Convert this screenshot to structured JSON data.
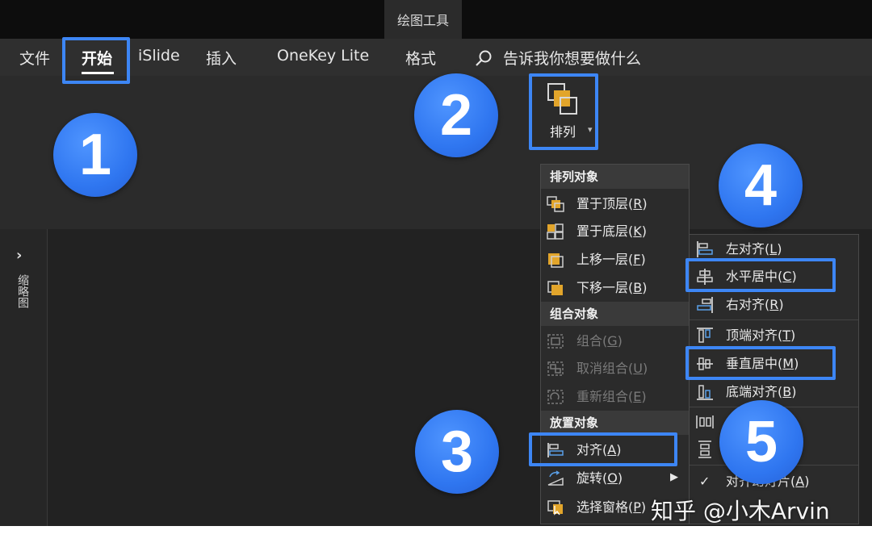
{
  "title_bar": {
    "context_tab": "绘图工具"
  },
  "ribbon_tabs": [
    "文件",
    "开始",
    "iSlide",
    "插入",
    "OneKey Lite",
    "格式"
  ],
  "search": {
    "text": "告诉我你想要做什么"
  },
  "ribbon": {
    "arrange_label": "排列"
  },
  "thumbnail_panel": {
    "label": "缩略图"
  },
  "arrange_menu": {
    "sections": [
      "排列对象",
      "组合对象",
      "放置对象"
    ],
    "items": [
      {
        "label": "置于顶层",
        "key": "R",
        "enabled": true
      },
      {
        "label": "置于底层",
        "key": "K",
        "enabled": true
      },
      {
        "label": "上移一层",
        "key": "F",
        "enabled": true
      },
      {
        "label": "下移一层",
        "key": "B",
        "enabled": true
      },
      {
        "label": "组合",
        "key": "G",
        "enabled": false
      },
      {
        "label": "取消组合",
        "key": "U",
        "enabled": false
      },
      {
        "label": "重新组合",
        "key": "E",
        "enabled": false
      },
      {
        "label": "对齐",
        "key": "A",
        "enabled": true
      },
      {
        "label": "旋转",
        "key": "O",
        "enabled": true
      },
      {
        "label": "选择窗格",
        "key": "P",
        "enabled": true
      }
    ]
  },
  "align_menu": {
    "items": [
      {
        "label": "左对齐",
        "key": "L"
      },
      {
        "label": "水平居中",
        "key": "C"
      },
      {
        "label": "右对齐",
        "key": "R"
      },
      {
        "label": "顶端对齐",
        "key": "T"
      },
      {
        "label": "垂直居中",
        "key": "M"
      },
      {
        "label": "底端对齐",
        "key": "B"
      },
      {
        "label": "对齐幻灯片",
        "key": "A"
      }
    ]
  },
  "step_badges": [
    "1",
    "2",
    "3",
    "4",
    "5"
  ],
  "watermark": "知乎 @小木Arvin",
  "colors": {
    "highlight": "#3d86f5",
    "badge": "#2f76f0",
    "icon_orange": "#e2a52b"
  }
}
